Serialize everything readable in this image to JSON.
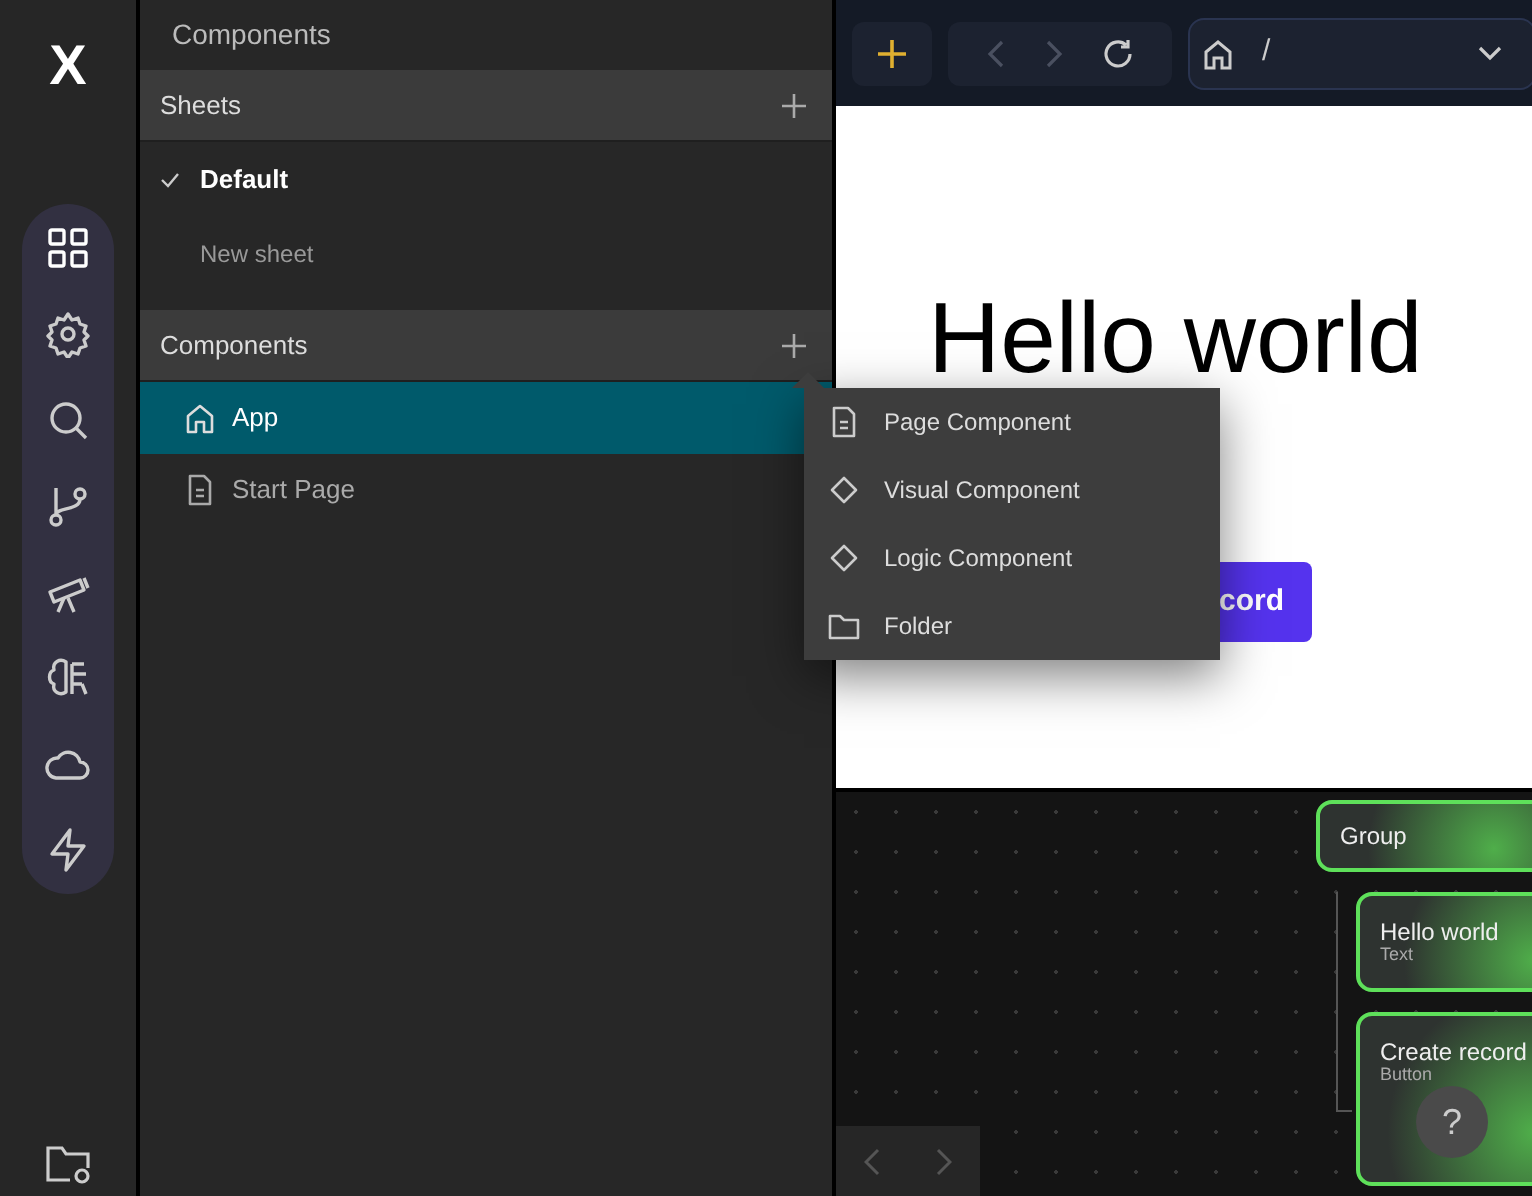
{
  "logo": "X",
  "panel": {
    "title": "Components",
    "sections": [
      {
        "title": "Sheets",
        "items": [
          {
            "label": "Default",
            "selected": true
          },
          {
            "label": "New sheet",
            "selected": false
          }
        ]
      },
      {
        "title": "Components",
        "items": [
          {
            "label": "App",
            "kind": "home",
            "selected": true
          },
          {
            "label": "Start Page",
            "kind": "page",
            "selected": false
          }
        ]
      }
    ]
  },
  "menu": {
    "items": [
      {
        "label": "Page Component",
        "kind": "page"
      },
      {
        "label": "Visual Component",
        "kind": "diamond"
      },
      {
        "label": "Logic Component",
        "kind": "diamond"
      },
      {
        "label": "Folder",
        "kind": "folder"
      }
    ]
  },
  "toolbar": {
    "path": "/"
  },
  "preview": {
    "heading": "Hello world",
    "button": "cord"
  },
  "canvas": {
    "nodes": [
      {
        "title": "Group"
      },
      {
        "title": "Hello world",
        "type": "Text"
      },
      {
        "title": "Create record",
        "type": "Button"
      }
    ],
    "help": "?"
  }
}
